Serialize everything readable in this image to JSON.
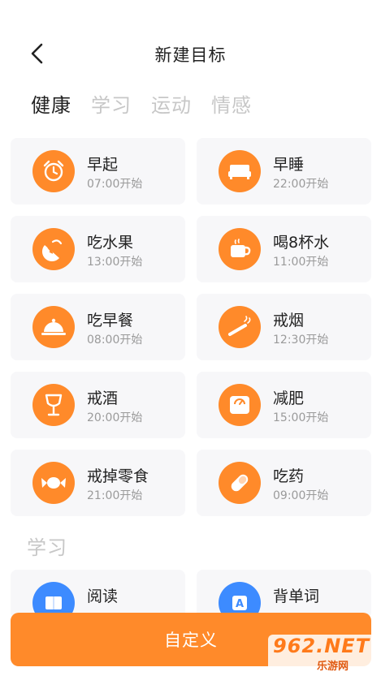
{
  "header": {
    "title": "新建目标"
  },
  "tabs": [
    {
      "label": "健康",
      "active": true
    },
    {
      "label": "学习",
      "active": false
    },
    {
      "label": "运动",
      "active": false
    },
    {
      "label": "情感",
      "active": false
    }
  ],
  "health_cards": [
    {
      "name": "早起",
      "time": "07:00开始",
      "icon": "alarm-clock-icon"
    },
    {
      "name": "早睡",
      "time": "22:00开始",
      "icon": "bed-icon"
    },
    {
      "name": "吃水果",
      "time": "13:00开始",
      "icon": "fruit-slice-icon"
    },
    {
      "name": "喝8杯水",
      "time": "11:00开始",
      "icon": "cup-icon"
    },
    {
      "name": "吃早餐",
      "time": "08:00开始",
      "icon": "food-cloche-icon"
    },
    {
      "name": "戒烟",
      "time": "12:30开始",
      "icon": "cigarette-icon"
    },
    {
      "name": "戒酒",
      "time": "20:00开始",
      "icon": "wine-glass-icon"
    },
    {
      "name": "减肥",
      "time": "15:00开始",
      "icon": "scale-icon"
    },
    {
      "name": "戒掉零食",
      "time": "21:00开始",
      "icon": "candy-icon"
    },
    {
      "name": "吃药",
      "time": "09:00开始",
      "icon": "pill-icon"
    }
  ],
  "study_section": {
    "title": "学习"
  },
  "study_cards": [
    {
      "name": "阅读",
      "icon": "book-icon"
    },
    {
      "name": "背单词",
      "icon": "letter-a-icon"
    }
  ],
  "custom_button": {
    "label": "自定义"
  },
  "watermark": {
    "main": "962.NET",
    "sub": "乐游网"
  },
  "colors": {
    "accent": "#ff8a2a",
    "blue": "#3d8bff",
    "card_bg": "#f7f7f9"
  }
}
